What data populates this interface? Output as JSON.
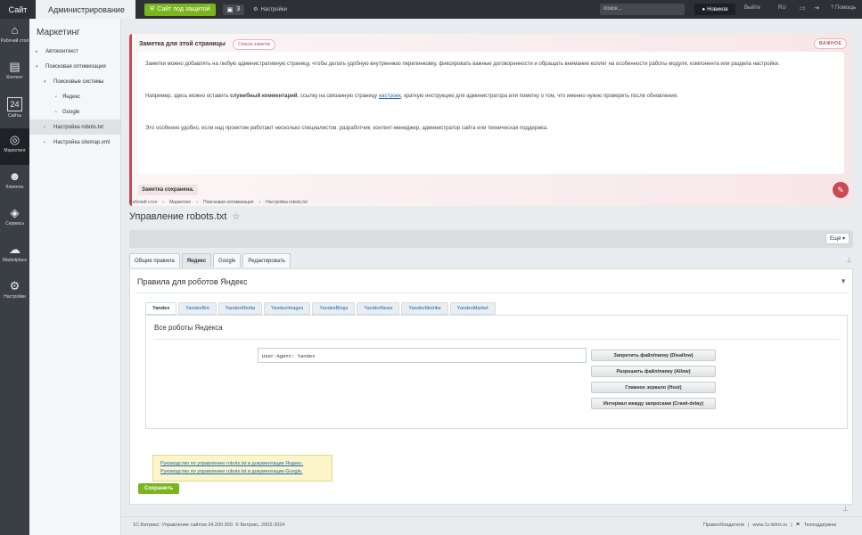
{
  "topbar": {
    "site_tab": "Сайт",
    "admin_tab": "Администрирование",
    "protect_label": "Сайт под защитой",
    "notif_count": "3",
    "settings_label": "Настройки",
    "search_placeholder": "поиск...",
    "user_name": "Новиков",
    "logout": "Выйти",
    "lang": "RU",
    "help": "Помощь"
  },
  "leftnav": {
    "items": [
      {
        "label": "Рабочий стол",
        "icon": "home-icon"
      },
      {
        "label": "Контент",
        "icon": "document-icon"
      },
      {
        "label": "Сайты",
        "icon": "calendar-icon",
        "glyph": "24"
      },
      {
        "label": "Маркетинг",
        "icon": "target-icon",
        "active": true
      },
      {
        "label": "Клиенты",
        "icon": "clients-icon"
      },
      {
        "label": "Сервисы",
        "icon": "layers-icon"
      },
      {
        "label": "Marketplace",
        "icon": "cloud-icon"
      },
      {
        "label": "Настройки",
        "icon": "gear-icon"
      }
    ]
  },
  "tree": {
    "title": "Маркетинг",
    "items": [
      "Автоконтекст",
      "Поисковая оптимизация",
      "Поисковые системы",
      "Яндекс",
      "Google",
      "Настройка robots.txt",
      "Настройка sitemap.xml"
    ]
  },
  "note": {
    "title": "Заметка для этой страницы",
    "list_label": "Список заметок",
    "badge": "ВАЖНОЕ",
    "p1": "Заметки можно добавлять на любую административную страницу, чтобы делать удобную внутреннюю перелинковку, фиксировать важные договоренности и обращать внимание коллег на особенности работы модуля, компонента или раздела настройки.",
    "p2_before": "Например, здесь можно оставить ",
    "p2_bold": "служебный комментарий",
    "p2_middle": ", ссылку на связанную страницу ",
    "p2_link": "настроек",
    "p2_after": ", краткую инструкцию для администратора или пометку о том, что именно нужно проверить после обновления.",
    "p3": "Это особенно удобно, если над проектом работают несколько специалистов: разработчик, контент-менеджер, администратор сайта или техническая поддержка.",
    "saved": "Заметка сохранена."
  },
  "breadcrumb": [
    "Рабочий стол",
    "Маркетинг",
    "Поисковая оптимизация",
    "Настройка robots.txt"
  ],
  "page": {
    "title": "Управление robots.txt",
    "more": "Ещё"
  },
  "tabs": [
    "Общие правила",
    "Яндекс",
    "Google",
    "Редактировать"
  ],
  "panel": {
    "title": "Правила для роботов Яндекс",
    "subtabs": [
      "Yandex",
      "YandexBot",
      "YandexMedia",
      "YandexImages",
      "YandexBlogs",
      "YandexNews",
      "YandexMetrika",
      "YandexMarket"
    ],
    "sub_title": "Все роботы Яндекса",
    "useragent": "User-Agent: Yandex",
    "actions": [
      "Запретить файл/папку (Disallow)",
      "Разрешить файл/папку (Allow)",
      "Главное зеркало (Host)",
      "Интервал между запросами (Crawl-delay)"
    ],
    "doc_yandex": "Руководство по управлению robots.txt в документации Яндекс.",
    "doc_google": "Руководство по управлению robots.txt в документации Google."
  },
  "save_label": "Сохранить",
  "footer": {
    "copyright": "1С-Битрикс: Управление сайтом 24.200.300. © Битрикс, 2002-2024",
    "links": [
      "Правообладатели",
      "www.1c-bitrix.ru",
      "Техподдержка"
    ]
  }
}
